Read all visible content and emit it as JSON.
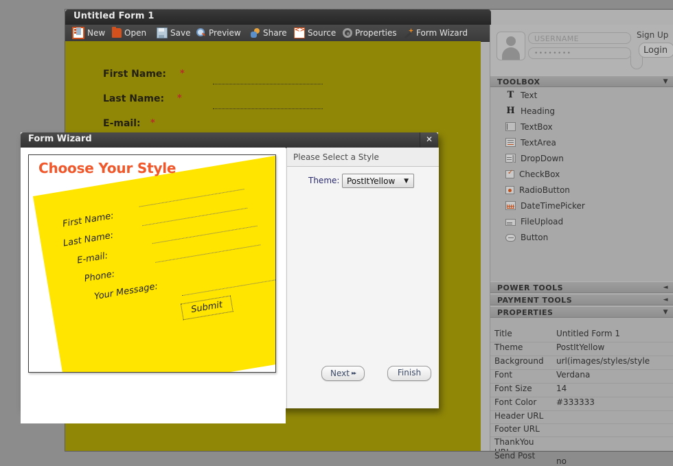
{
  "window": {
    "title": "Untitled Form 1",
    "toolbar": [
      {
        "label": "New",
        "icon": "new-document-icon"
      },
      {
        "label": "Open",
        "icon": "open-folder-icon"
      },
      {
        "label": "Save",
        "icon": "floppy-disk-icon"
      },
      {
        "label": "Preview",
        "icon": "magnifier-icon"
      },
      {
        "label": "Share",
        "icon": "people-icon"
      },
      {
        "label": "Source",
        "icon": "code-brackets-icon"
      },
      {
        "label": "Properties",
        "icon": "gear-icon"
      },
      {
        "label": "Form Wizard",
        "icon": "magic-wand-icon"
      }
    ]
  },
  "canvas": {
    "fields": [
      {
        "label": "First Name:",
        "required": "*"
      },
      {
        "label": "Last Name:",
        "required": "*"
      },
      {
        "label": "E-mail:",
        "required": "*"
      }
    ]
  },
  "account": {
    "username_placeholder": "USERNAME",
    "password_value": "••••••••",
    "signup_label": "Sign Up",
    "login_label": "Login"
  },
  "panels": {
    "toolbox": {
      "title": "TOOLBOX",
      "arrow": "▼"
    },
    "power_tools": {
      "title": "POWER TOOLS",
      "arrow": "◄"
    },
    "payment_tools": {
      "title": "PAYMENT TOOLS",
      "arrow": "◄"
    },
    "properties": {
      "title": "PROPERTIES",
      "arrow": "▼"
    }
  },
  "toolbox_items": [
    {
      "label": "Text",
      "icon": "text-t-icon"
    },
    {
      "label": "Heading",
      "icon": "heading-h-icon"
    },
    {
      "label": "TextBox",
      "icon": "textbox-icon"
    },
    {
      "label": "TextArea",
      "icon": "textarea-icon"
    },
    {
      "label": "DropDown",
      "icon": "dropdown-icon"
    },
    {
      "label": "CheckBox",
      "icon": "checkbox-icon"
    },
    {
      "label": "RadioButton",
      "icon": "radiobutton-icon"
    },
    {
      "label": "DateTimePicker",
      "icon": "calendar-icon"
    },
    {
      "label": "FileUpload",
      "icon": "fileupload-icon"
    },
    {
      "label": "Button",
      "icon": "button-icon"
    }
  ],
  "properties_rows": [
    {
      "key": "Title",
      "value": "Untitled Form 1"
    },
    {
      "key": "Theme",
      "value": "PostItYellow"
    },
    {
      "key": "Background",
      "value": "url(images/styles/style"
    },
    {
      "key": "Font",
      "value": "Verdana"
    },
    {
      "key": "Font Size",
      "value": "14"
    },
    {
      "key": "Font Color",
      "value": "#333333"
    },
    {
      "key": "Header URL",
      "value": ""
    },
    {
      "key": "Footer URL",
      "value": ""
    },
    {
      "key": "ThankYou URL",
      "value": ""
    },
    {
      "key": "Send Post",
      "value": "no"
    }
  ],
  "wizard": {
    "title": "Form Wizard",
    "close_label": "✕",
    "preview_title": "Choose Your Style",
    "postit_labels": [
      "First Name:",
      "Last Name:",
      "E-mail:",
      "Phone:",
      "Your Message:"
    ],
    "submit_label": "Submit",
    "right_header": "Please Select a Style",
    "theme_label": "Theme:",
    "theme_value": "PostItYellow",
    "theme_caret": "▼",
    "next_label": "Next",
    "next_glyph": "▸▸",
    "finish_label": "Finish"
  },
  "colors": {
    "accent_orange": "#f0572b",
    "postit_yellow": "#ffe500",
    "canvas_olive": "#9a9008",
    "required_red": "#c2302b"
  }
}
